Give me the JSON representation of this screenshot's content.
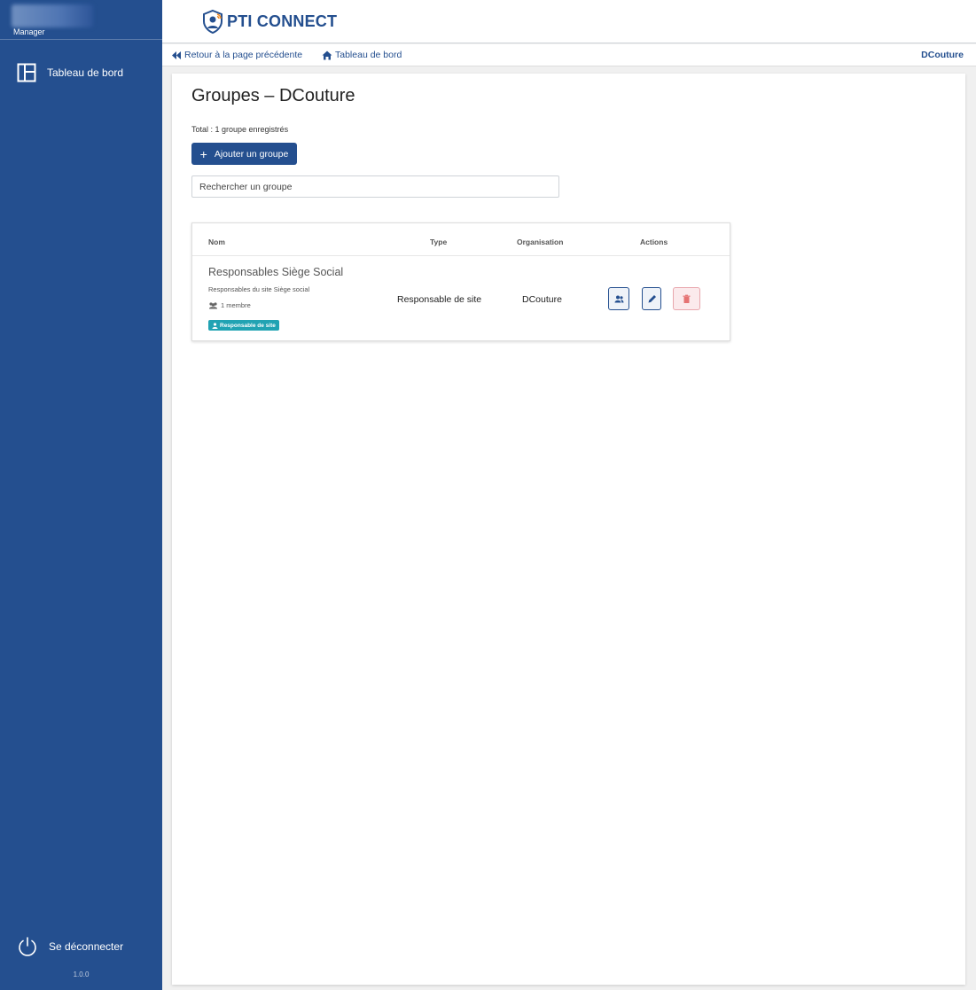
{
  "sidebar": {
    "role": "Manager",
    "nav": [
      {
        "label": "Tableau de bord",
        "icon": "dashboard-icon"
      }
    ],
    "logout_label": "Se déconnecter",
    "version": "1.0.0"
  },
  "header": {
    "logo_text": "PTI CONNECT"
  },
  "breadcrumb": {
    "back_label": "Retour à la page précédente",
    "home_label": "Tableau de bord",
    "org": "DCouture"
  },
  "main": {
    "title": "Groupes – DCouture",
    "total_text": "Total : 1 groupe enregistrés",
    "add_button_label": "Ajouter un groupe",
    "search_placeholder": "Rechercher un groupe",
    "table": {
      "headers": {
        "name": "Nom",
        "type": "Type",
        "organisation": "Organisation",
        "actions": "Actions"
      },
      "rows": [
        {
          "name": "Responsables Siège Social",
          "description": "Responsables du site Siège social",
          "members": "1 membre",
          "badge": "Responsable de site",
          "type": "Responsable de site",
          "organisation": "DCouture"
        }
      ]
    }
  },
  "colors": {
    "brand": "#244f8f",
    "badge": "#21a3b3",
    "danger": "#e57373"
  }
}
